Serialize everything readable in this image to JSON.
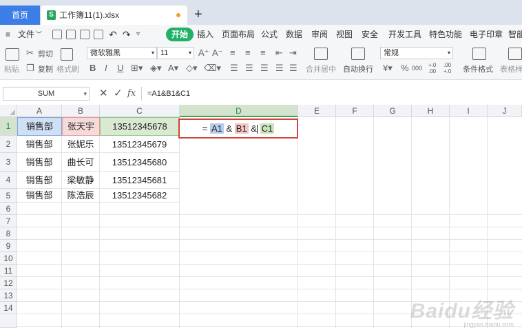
{
  "tabs": {
    "home": "首页",
    "file_icon": "S",
    "file": "工作簿11(1).xlsx",
    "add": "+"
  },
  "menu": {
    "file": "文件",
    "items": [
      "开始",
      "插入",
      "页面布局",
      "公式",
      "数据",
      "审阅",
      "视图",
      "安全",
      "开发工具",
      "特色功能",
      "电子印章",
      "智能"
    ]
  },
  "ribbon": {
    "paste": "粘贴",
    "cut": "剪切",
    "copy": "复制",
    "format_painter": "格式刷",
    "font_name": "微软雅黑",
    "font_size": "11",
    "number_format": "常规",
    "merge_center": "合并居中",
    "wrap_text": "自动换行",
    "cond_format": "条件格式",
    "table_style": "表格样",
    "bold": "B",
    "italic": "I",
    "underline": "U",
    "percent": "%",
    "thousands": "000",
    "inc_dec": "+.0 .00",
    "dec_dec": ".00 +.0"
  },
  "formula_bar": {
    "name_box": "SUM",
    "fx": "fx",
    "formula": "=A1&B1&C1"
  },
  "columns": [
    "A",
    "B",
    "C",
    "D",
    "E",
    "F",
    "G",
    "H",
    "I",
    "J"
  ],
  "selected_column": "D",
  "rows": [
    "1",
    "2",
    "3",
    "4",
    "5",
    "6",
    "7",
    "8",
    "9",
    "10",
    "11",
    "12",
    "13",
    "14"
  ],
  "data": [
    [
      "销售部",
      "张天宇",
      "13512345678"
    ],
    [
      "销售部",
      "张妮乐",
      "13512345679"
    ],
    [
      "销售部",
      "曲长可",
      "13512345680"
    ],
    [
      "销售部",
      "梁敏静",
      "13512345681"
    ],
    [
      "销售部",
      "陈浩辰",
      "13512345682"
    ]
  ],
  "edit": {
    "eq": "=",
    "a": "A1",
    "amp1": "&",
    "b": "B1",
    "amp2": "&",
    "c": "C1"
  },
  "watermark": {
    "brand": "Baidu经验",
    "url": "jingyan.baidu.com"
  },
  "colors": {
    "accent_green": "#20b167",
    "active_border": "#d0443a",
    "ref_a": "#cfe0f5",
    "ref_b": "#f6d9d9",
    "ref_c": "#d9e9d2"
  }
}
